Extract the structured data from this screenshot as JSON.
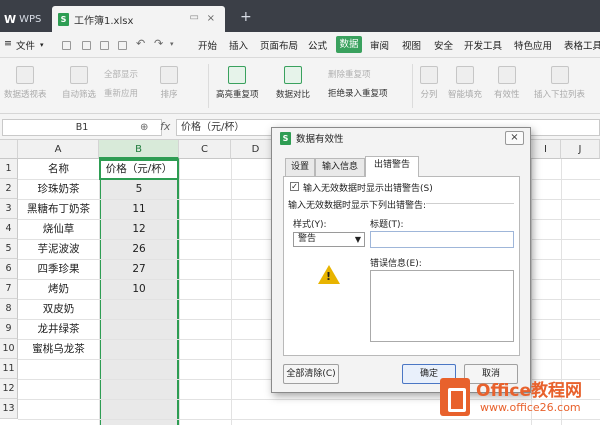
{
  "titlebar": {
    "app_tab": "WPS",
    "file_tab": "工作簿1.xlsx",
    "file_icon": "S",
    "add_tab": "+"
  },
  "menubar": {
    "file_menu": "文件",
    "items": [
      "开始",
      "插入",
      "页面布局",
      "公式",
      "数据",
      "审阅",
      "视图",
      "安全",
      "开发工具",
      "特色应用",
      "表格工具"
    ],
    "active": "数据"
  },
  "ribbon": {
    "pivot": "数据透视表",
    "autofilter": "自动筛选",
    "show_all": "全部显示",
    "reapply": "重新应用",
    "sort": "排序",
    "highlight_dup": "高亮重复项",
    "compare": "数据对比",
    "remove_dup": "删除重复项",
    "reject_dup": "拒绝录入重复项",
    "split": "分列",
    "smart_fill": "智能填充",
    "validity": "有效性",
    "insert_dropdown": "插入下拉列表"
  },
  "formula_bar": {
    "name_box": "B1",
    "fx": "fx",
    "content": "价格（元/杯）"
  },
  "sheet": {
    "columns": [
      "A",
      "B",
      "C",
      "D",
      "I",
      "J"
    ],
    "selected_column": "B",
    "row_numbers": [
      "1",
      "2",
      "3",
      "4",
      "5",
      "6",
      "7",
      "8",
      "9",
      "10",
      "11",
      "12",
      "13"
    ],
    "header_name": "名称",
    "header_price": "价格（元/杯）",
    "rows": [
      {
        "name": "珍珠奶茶",
        "price": "5"
      },
      {
        "name": "黑糖布丁奶茶",
        "price": "11"
      },
      {
        "name": "烧仙草",
        "price": "12"
      },
      {
        "name": "芋泥波波",
        "price": "26"
      },
      {
        "name": "四季珍果",
        "price": "27"
      },
      {
        "name": "烤奶",
        "price": "10"
      },
      {
        "name": "双皮奶",
        "price": ""
      },
      {
        "name": "龙井绿茶",
        "price": ""
      },
      {
        "name": "蜜桃乌龙茶",
        "price": ""
      }
    ]
  },
  "dialog": {
    "title": "数据有效性",
    "close": "×",
    "tabs": [
      "设置",
      "输入信息",
      "出错警告"
    ],
    "active_tab": "出错警告",
    "show_error_checkbox": "输入无效数据时显示出错警告(S)",
    "checked": true,
    "group_label": "输入无效数据时显示下列出错警告:",
    "style_label": "样式(Y):",
    "style_value": "警告",
    "title_label": "标题(T):",
    "title_value": "",
    "error_label": "错误信息(E):",
    "error_value": "",
    "clear_all": "全部清除(C)",
    "ok": "确定",
    "cancel": "取消"
  },
  "watermark": {
    "brand": "Office教程网",
    "url": "www.office26.com"
  },
  "colors": {
    "title_bar": "#3b3f47",
    "accent_green": "#2e9d53",
    "brand_orange": "#e8612c"
  }
}
